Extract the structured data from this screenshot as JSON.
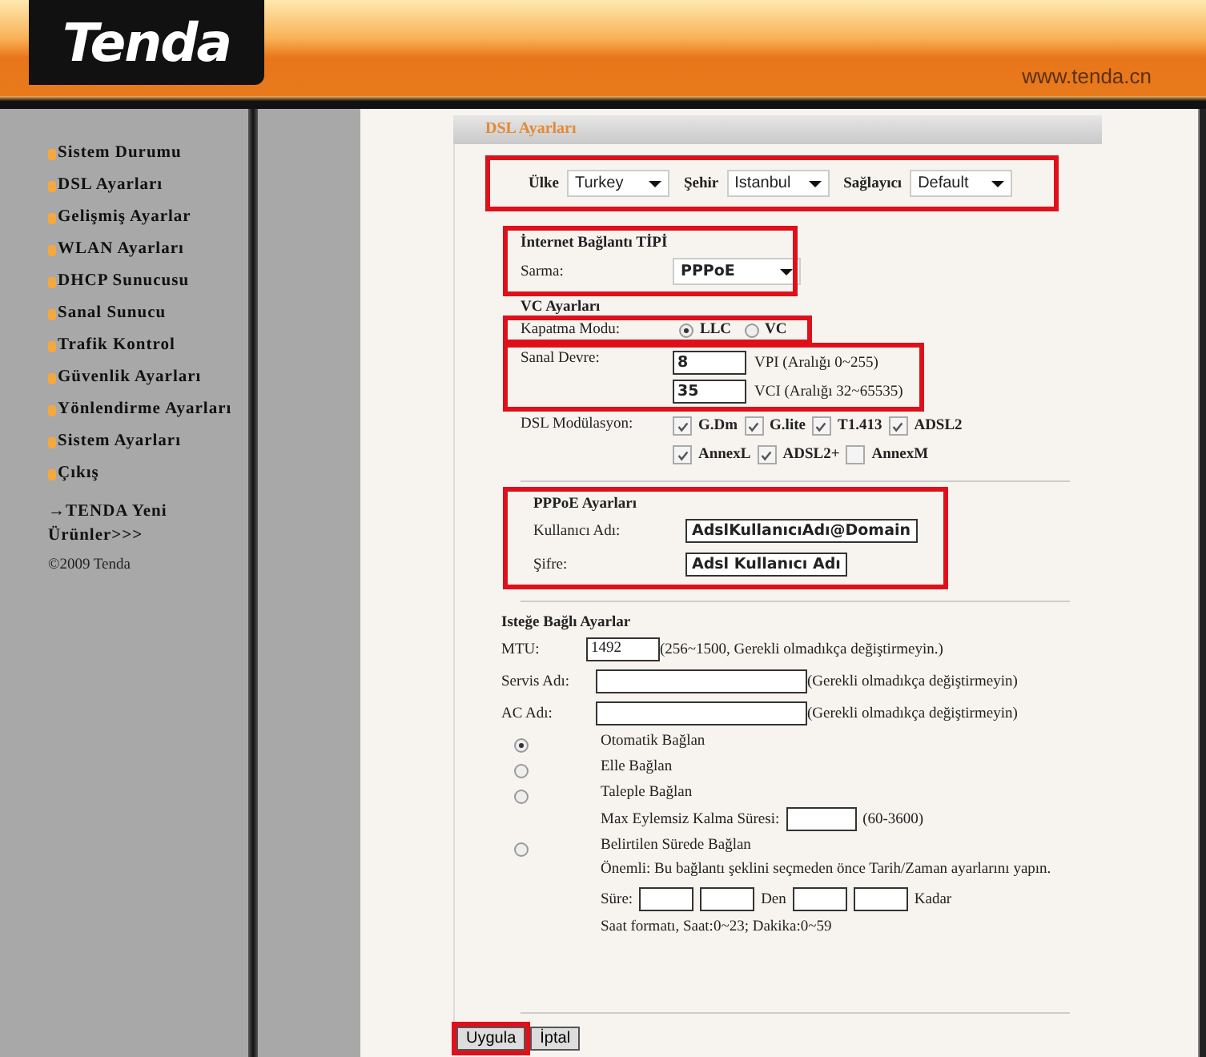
{
  "header": {
    "logo": "Tenda",
    "url": "www.tenda.cn"
  },
  "sidebar": {
    "items": [
      {
        "label": "Sistem Durumu"
      },
      {
        "label": "DSL Ayarları"
      },
      {
        "label": "Gelişmiş Ayarlar"
      },
      {
        "label": "WLAN Ayarları"
      },
      {
        "label": "DHCP Sunucusu"
      },
      {
        "label": "Sanal Sunucu"
      },
      {
        "label": "Trafik Kontrol"
      },
      {
        "label": "Güvenlik Ayarları"
      },
      {
        "label": "Yönlendirme Ayarları"
      },
      {
        "label": "Sistem Ayarları"
      },
      {
        "label": "Çıkış"
      }
    ],
    "promo": "→TENDA Yeni Ürünler>>>",
    "copyright": "©2009 Tenda"
  },
  "panel": {
    "title": "DSL Ayarları"
  },
  "location": {
    "highlighted": true,
    "fields": [
      {
        "label": "Ülke",
        "value": "Turkey"
      },
      {
        "label": "Şehir",
        "value": "Istanbul"
      },
      {
        "label": "Sağlayıcı",
        "value": "Default"
      }
    ]
  },
  "connection": {
    "highlighted": true,
    "heading": "İnternet Bağlantı TİPİ",
    "label": "Sarma:",
    "value": "PPPoE"
  },
  "vc_heading": "VC Ayarları",
  "encapsulation": {
    "highlighted": true,
    "label": "Kapatma Modu:",
    "options": [
      {
        "label": "LLC",
        "selected": true
      },
      {
        "label": "VC",
        "selected": false
      }
    ]
  },
  "circuit": {
    "highlighted": true,
    "label": "Sanal Devre:",
    "rows": [
      {
        "value": "8",
        "hint": "VPI (Aralığı 0~255)"
      },
      {
        "value": "35",
        "hint": "VCI (Aralığı 32~65535)"
      }
    ]
  },
  "modulation": {
    "label": "DSL Modülasyon:",
    "options": [
      {
        "label": "G.Dm",
        "checked": true
      },
      {
        "label": "G.lite",
        "checked": true
      },
      {
        "label": "T1.413",
        "checked": true
      },
      {
        "label": "ADSL2",
        "checked": true
      },
      {
        "label": "AnnexL",
        "checked": true
      },
      {
        "label": "ADSL2+",
        "checked": true
      },
      {
        "label": "AnnexM",
        "checked": false
      }
    ]
  },
  "pppoe": {
    "highlighted": true,
    "heading": "PPPoE Ayarları",
    "fields": [
      {
        "label": "Kullanıcı Adı:",
        "value": "AdslKullanıcıAdı@Domain"
      },
      {
        "label": "Şifre:",
        "value": "Adsl Kullanıcı Adı"
      }
    ]
  },
  "optional": {
    "heading": "Isteğe Bağlı Ayarlar",
    "mtu": {
      "label": "MTU:",
      "value": "1492",
      "hint": "(256~1500, Gerekli olmadıkça değiştirmeyin.)"
    },
    "fields": [
      {
        "label": "Servis Adı:",
        "hint": "(Gerekli olmadıkça değiştirmeyin)"
      },
      {
        "label": "AC Adı:",
        "hint": "(Gerekli olmadıkça değiştirmeyin)"
      }
    ],
    "modes": [
      {
        "kind": "plain",
        "label": "Otomatik Bağlan",
        "selected": true
      },
      {
        "kind": "plain",
        "label": "Elle Bağlan",
        "selected": false
      },
      {
        "kind": "idle",
        "label": "Taleple Bağlan",
        "selected": false,
        "idle_label": "Max Eylemsiz Kalma Süresi:",
        "idle_hint": "(60-3600)"
      },
      {
        "kind": "timed",
        "label": "Belirtilen Sürede Bağlan",
        "selected": false,
        "note": "Önemli: Bu bağlantı şeklini seçmeden önce Tarih/Zaman ayarlarını yapın.",
        "time_label": "Süre:",
        "from": "Den",
        "to": "Kadar",
        "format": "Saat formatı, Saat:0~23; Dakika:0~59"
      }
    ]
  },
  "buttons": [
    {
      "label": "Uygula",
      "highlighted": true
    },
    {
      "label": "İptal",
      "highlighted": false
    }
  ]
}
